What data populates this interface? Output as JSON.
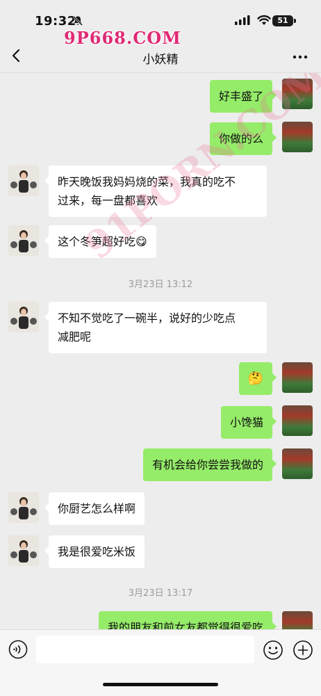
{
  "status_bar": {
    "time": "19:32",
    "battery": "51"
  },
  "watermark": "9P668.COM",
  "watermark_mid": "91PORN.COM",
  "header": {
    "title": "小妖精"
  },
  "messages": [
    {
      "side": "right",
      "text": "好丰盛了"
    },
    {
      "side": "right",
      "text": "你做的么"
    },
    {
      "side": "left",
      "text": "昨天晚饭我妈妈烧的菜，我真的吃不过来，每一盘都喜欢",
      "line1": "昨天晚饭我妈妈烧的菜，我真的吃不",
      "line2": "过来，每一盘都喜欢"
    },
    {
      "side": "left",
      "text": "这个冬笋超好吃😋"
    },
    {
      "side": "left",
      "text": "不知不觉吃了一碗半，说好的少吃点减肥呢",
      "line1": "不知不觉吃了一碗半，说好的少吃点",
      "line2": "减肥呢"
    },
    {
      "side": "right",
      "text": "🤔"
    },
    {
      "side": "right",
      "text": "小馋猫"
    },
    {
      "side": "right",
      "text": "有机会给你尝尝我做的"
    },
    {
      "side": "left",
      "text": "你厨艺怎么样啊"
    },
    {
      "side": "left",
      "text": "我是很爱吃米饭"
    },
    {
      "side": "right",
      "text": "我的朋友和前女友都觉得很爱吃"
    }
  ],
  "timestamps": [
    "3月23日 13:12",
    "3月23日 13:17"
  ],
  "colors": {
    "bubble_self": "#95ec69",
    "bubble_other": "#ffffff",
    "background": "#ededed"
  },
  "icons": [
    "back-icon",
    "more-icon",
    "voice-icon",
    "emoji-icon",
    "plus-icon",
    "bell-muted-icon",
    "signal-icon",
    "wifi-icon",
    "battery-icon"
  ]
}
